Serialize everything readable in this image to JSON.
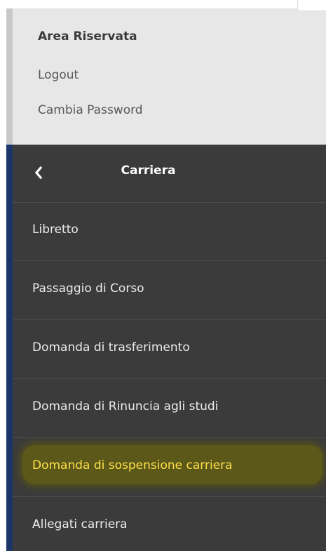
{
  "area": {
    "title": "Area Riservata",
    "logout": "Logout",
    "change_password": "Cambia Password"
  },
  "menu": {
    "title": "Carriera",
    "back_icon": "chevron-left-icon",
    "items": [
      {
        "label": "Libretto"
      },
      {
        "label": "Passaggio di Corso"
      },
      {
        "label": "Domanda di trasferimento"
      },
      {
        "label": "Domanda di Rinuncia agli studi"
      },
      {
        "label": "Domanda di sospensione carriera",
        "highlighted": true
      },
      {
        "label": "Allegati carriera"
      }
    ]
  },
  "colors": {
    "menu_bg": "#3b3b3b",
    "accent_bar": "#1c3569",
    "highlight_text": "#ffe14a",
    "top_panel_bg": "#e7e7e7"
  }
}
